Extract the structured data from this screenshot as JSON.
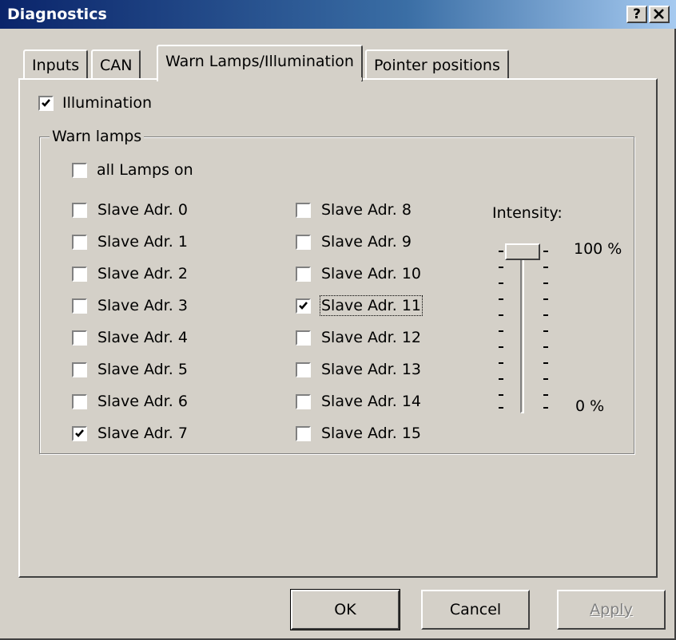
{
  "window": {
    "title": "Diagnostics",
    "help_button": "?",
    "close_button": "✕"
  },
  "tabs": [
    "Inputs",
    "CAN",
    "Warn Lamps/Illumination",
    "Pointer positions"
  ],
  "active_tab": "Warn Lamps/Illumination",
  "illumination": {
    "label": "Illumination",
    "checked": true
  },
  "warn_lamps": {
    "group_title": "Warn lamps",
    "all_lamps": {
      "label": "all Lamps on",
      "checked": false
    },
    "column1": [
      {
        "label": "Slave Adr. 0",
        "checked": false
      },
      {
        "label": "Slave Adr. 1",
        "checked": false
      },
      {
        "label": "Slave Adr. 2",
        "checked": false
      },
      {
        "label": "Slave Adr. 3",
        "checked": false
      },
      {
        "label": "Slave Adr. 4",
        "checked": false
      },
      {
        "label": "Slave Adr. 5",
        "checked": false
      },
      {
        "label": "Slave Adr. 6",
        "checked": false
      },
      {
        "label": "Slave Adr. 7",
        "checked": true
      }
    ],
    "column2": [
      {
        "label": "Slave Adr. 8",
        "checked": false
      },
      {
        "label": "Slave Adr. 9",
        "checked": false
      },
      {
        "label": "Slave Adr. 10",
        "checked": false
      },
      {
        "label": "Slave Adr. 11",
        "checked": true
      },
      {
        "label": "Slave Adr. 12",
        "checked": false
      },
      {
        "label": "Slave Adr. 13",
        "checked": false
      },
      {
        "label": "Slave Adr. 14",
        "checked": false
      },
      {
        "label": "Slave Adr. 15",
        "checked": false
      }
    ],
    "focused_item": "Slave Adr. 11"
  },
  "intensity": {
    "label": "Intensity:",
    "max_label": "100 %",
    "min_label": "0 %",
    "value_percent": 100
  },
  "buttons": {
    "ok": "OK",
    "cancel": "Cancel",
    "apply": "Apply",
    "apply_disabled": true
  }
}
